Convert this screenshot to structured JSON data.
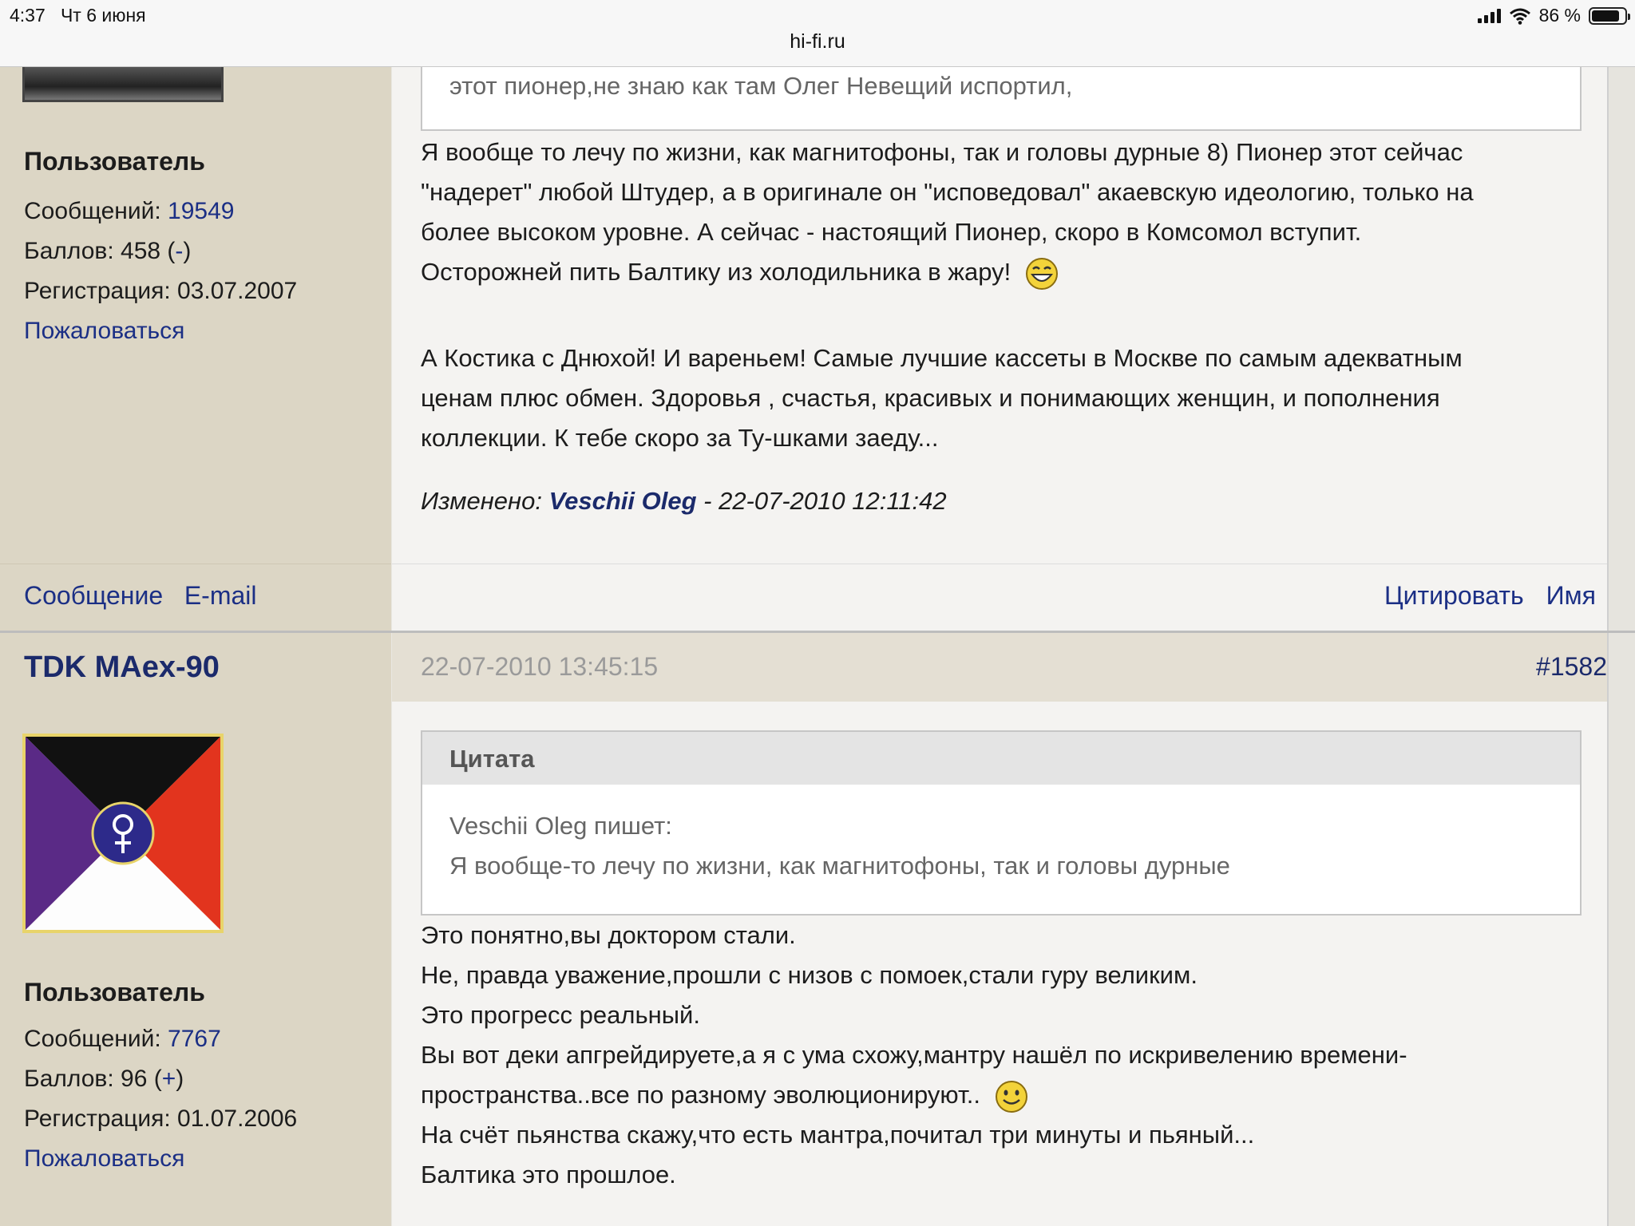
{
  "statusbar": {
    "time": "4:37",
    "date": "Чт 6 июня",
    "url": "hi-fi.ru",
    "battery": "86 %",
    "battery_level": 0.86
  },
  "post1": {
    "role": "Пользователь",
    "messages_label": "Сообщений:",
    "messages_count": "19549",
    "points_label": "Баллов: 458 (",
    "points_action": "-",
    "points_close": ")",
    "registration": "Регистрация: 03.07.2007",
    "report": "Пожаловаться",
    "quote_tail": "этот пионер,не знаю как там Олег Невещий испортил,",
    "text_lines": [
      "Я вообще то лечу по жизни, как магнитофоны, так и головы дурные 8) Пионер этот сейчас",
      "\"надерет\" любой Штудер, а в оригинале он \"исповедовал\" акаевскую идеологию, только на",
      "более высоком уровне. А сейчас - настоящий Пионер, скоро в Комсомол вступит.",
      "Осторожней пить Балтику из холодильника в жару!"
    ],
    "text2_lines": [
      "А Костика с Днюхой! И вареньем! Самые лучшие кассеты в Москве по самым адекватным",
      "ценам плюс обмен. Здоровья , счастья, красивых и понимающих женщин, и пополнения",
      "коллекции. К тебе скоро за Ту-шками заеду..."
    ],
    "edited_label": "Изменено:",
    "edited_by": "Veschii Oleg",
    "edited_date": "- 22-07-2010 12:11:42",
    "message_link": "Сообщение",
    "email_link": "E-mail",
    "quote_button": "Цитировать",
    "name_button": "Имя"
  },
  "post2": {
    "author": "TDK MAex-90",
    "role": "Пользователь",
    "messages_label": "Сообщений:",
    "messages_count": "7767",
    "points_label": "Баллов: 96 (",
    "points_action": "+",
    "points_close": ")",
    "registration": "Регистрация: 01.07.2006",
    "report": "Пожаловаться",
    "date": "22-07-2010 13:45:15",
    "number": "#1582",
    "quote_title": "Цитата",
    "quote_author": "Veschii Oleg пишет:",
    "quote_text": "Я вообще-то лечу по жизни, как магнитофоны, так и головы дурные",
    "text_lines": [
      "Это понятно,вы доктором стали.",
      "Не, правда уважение,прошли с низов с помоек,стали гуру великим.",
      "Это прогресс реальный.",
      "Вы вот деки апгрейдируете,а я с ума схожу,мантру нашёл по искривелению времени-",
      "пространства..все по разному эволюционируют..",
      "На счёт пьянства скажу,что есть мантра,почитал три минуты и пьяный...",
      "Балтика это прошлое."
    ]
  },
  "colors": {
    "link": "#1b2f85",
    "sidebar_bg": "#dcd6c5",
    "main_bg": "#f4f3f1"
  }
}
